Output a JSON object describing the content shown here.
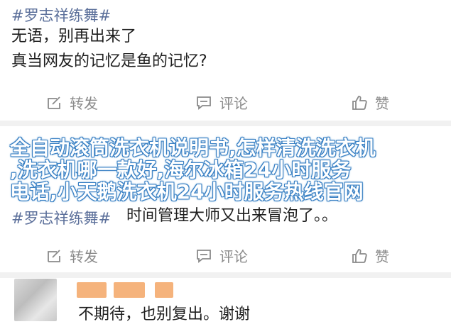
{
  "post1": {
    "hashtag": "#罗志祥练舞#",
    "line1": "无语，别再出来了",
    "line2": "真当网友的记忆是鱼的记忆?"
  },
  "actions1": {
    "repost": "转发",
    "comment": "评论",
    "like": "赞"
  },
  "overlay": {
    "line1": "全自动滚筒洗衣机说明书,怎样清洗洗衣机",
    "line2": ",洗衣机哪一款好,海尔冰箱24小时服务",
    "line3": "电话,小天鹅洗衣机24小时服务热线官网"
  },
  "post2": {
    "hashtag": "#罗志祥练舞#",
    "text": "时间管理大师又出来冒泡了。。"
  },
  "actions2": {
    "repost": "转发",
    "comment": "评论",
    "like": "赞"
  },
  "reply": {
    "text": "不期待，也别复出。谢谢"
  },
  "colors": {
    "hashtag": "#5b6f9a",
    "overlay_outline": "#3a80c4",
    "name_blur": "#f5b37c"
  },
  "icons": {
    "repost": "repost-icon",
    "comment": "comment-icon",
    "like": "thumbs-up-icon"
  }
}
